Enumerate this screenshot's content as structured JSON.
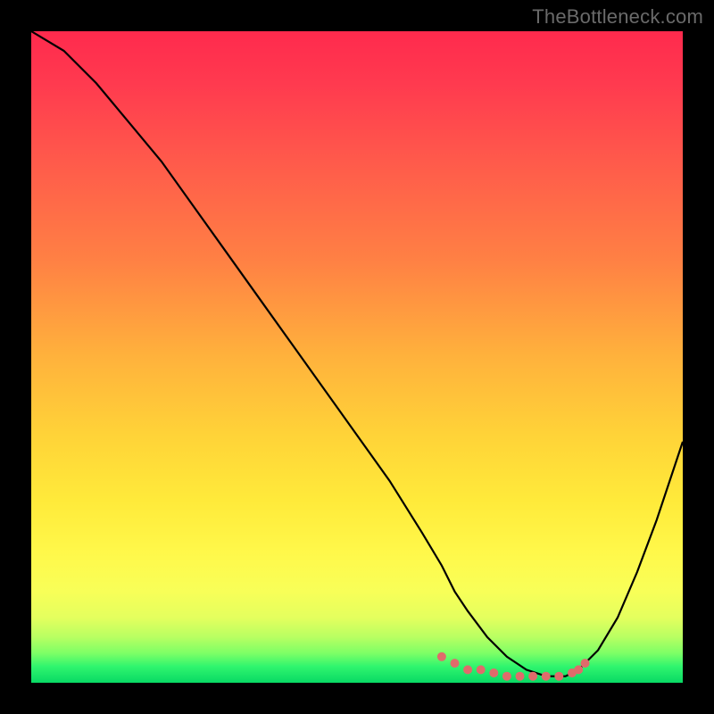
{
  "watermark": "TheBottleneck.com",
  "chart_data": {
    "type": "line",
    "title": "",
    "xlabel": "",
    "ylabel": "",
    "xlim": [
      0,
      100
    ],
    "ylim": [
      0,
      100
    ],
    "grid": false,
    "series": [
      {
        "name": "bottleneck-curve",
        "x": [
          0,
          5,
          10,
          15,
          20,
          25,
          30,
          35,
          40,
          45,
          50,
          55,
          60,
          63,
          65,
          67,
          70,
          73,
          76,
          79,
          82,
          84,
          87,
          90,
          93,
          96,
          100
        ],
        "values": [
          100,
          97,
          92,
          86,
          80,
          73,
          66,
          59,
          52,
          45,
          38,
          31,
          23,
          18,
          14,
          11,
          7,
          4,
          2,
          1,
          1,
          2,
          5,
          10,
          17,
          25,
          37
        ]
      }
    ],
    "markers": {
      "name": "highlight-band",
      "x": [
        63,
        65,
        67,
        69,
        71,
        73,
        75,
        77,
        79,
        81,
        83,
        84,
        85
      ],
      "values": [
        4,
        3,
        2,
        2,
        1.5,
        1,
        1,
        1,
        1,
        1,
        1.5,
        2,
        3
      ],
      "color": "#e06b6b",
      "size": 10
    },
    "gradient_stops": [
      {
        "offset": 0.0,
        "color": "#ff2a4d"
      },
      {
        "offset": 0.08,
        "color": "#ff3a4f"
      },
      {
        "offset": 0.2,
        "color": "#ff5a4b"
      },
      {
        "offset": 0.35,
        "color": "#ff8044"
      },
      {
        "offset": 0.5,
        "color": "#ffb23c"
      },
      {
        "offset": 0.62,
        "color": "#ffd338"
      },
      {
        "offset": 0.72,
        "color": "#ffea3a"
      },
      {
        "offset": 0.8,
        "color": "#fff84a"
      },
      {
        "offset": 0.86,
        "color": "#f8ff58"
      },
      {
        "offset": 0.9,
        "color": "#e4ff5e"
      },
      {
        "offset": 0.93,
        "color": "#b8ff62"
      },
      {
        "offset": 0.955,
        "color": "#7cff66"
      },
      {
        "offset": 0.975,
        "color": "#30f56e"
      },
      {
        "offset": 1.0,
        "color": "#08d964"
      }
    ]
  }
}
